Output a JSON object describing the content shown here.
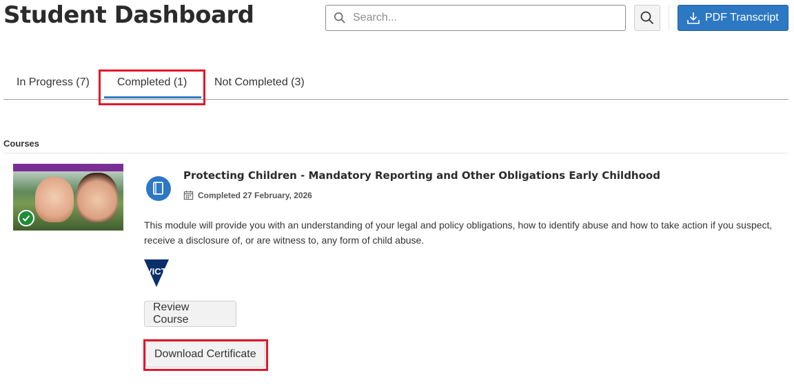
{
  "header": {
    "title": "Student Dashboard",
    "search_placeholder": "Search...",
    "pdf_button_label": "PDF Transcript",
    "accent_color": "#2d78c2"
  },
  "tabs": [
    {
      "label": "In Progress (7)",
      "active": false
    },
    {
      "label": "Completed (1)",
      "active": true
    },
    {
      "label": "Not Completed (3)",
      "active": false
    }
  ],
  "section": {
    "label": "Courses"
  },
  "course": {
    "title": "Protecting Children - Mandatory Reporting and Other Obligations Early Childhood",
    "completed_text": "Completed 27 February, 2026",
    "description": "This module will provide you with an understanding of your legal and policy obligations, how to identify abuse and how to take action if you suspect, receive a disclosure of, or are witness to, any form of child abuse.",
    "logo_text": "VICTORIA",
    "status_icon": "check-circle-icon",
    "type_icon": "book-icon",
    "buttons": {
      "review": "Review Course",
      "certificate": "Download Certificate"
    }
  },
  "highlight_color": "#e3162b"
}
